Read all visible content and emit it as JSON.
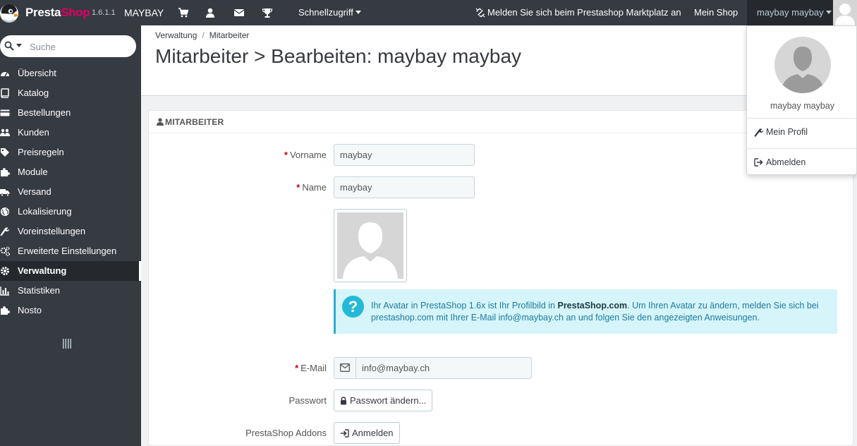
{
  "header": {
    "logo_presta": "Presta",
    "logo_shop": "Shop",
    "version": "1.6.1.1",
    "shop_name": "MAYBAY",
    "quick_access": "Schnellzugriff",
    "marketplace": "Melden Sie sich beim Prestashop Marktplatz an",
    "my_shop": "Mein Shop",
    "user": "maybay maybay"
  },
  "search": {
    "placeholder": "Suche"
  },
  "sidebar": {
    "items": [
      {
        "label": "Übersicht",
        "icon": "dashboard-icon"
      },
      {
        "label": "Katalog",
        "icon": "book-icon"
      },
      {
        "label": "Bestellungen",
        "icon": "credit-card-icon"
      },
      {
        "label": "Kunden",
        "icon": "users-icon"
      },
      {
        "label": "Preisregeln",
        "icon": "tags-icon"
      },
      {
        "label": "Module",
        "icon": "puzzle-icon"
      },
      {
        "label": "Versand",
        "icon": "truck-icon"
      },
      {
        "label": "Lokalisierung",
        "icon": "globe-icon"
      },
      {
        "label": "Voreinstellungen",
        "icon": "wrench-icon"
      },
      {
        "label": "Erweiterte Einstellungen",
        "icon": "cogs-icon"
      },
      {
        "label": "Verwaltung",
        "icon": "cog-icon",
        "active": true
      },
      {
        "label": "Statistiken",
        "icon": "bar-chart-icon"
      },
      {
        "label": "Nosto",
        "icon": "puzzle-icon"
      }
    ]
  },
  "breadcrumb": {
    "parent": "Verwaltung",
    "sep": "/",
    "current": "Mitarbeiter"
  },
  "page_title": "Mitarbeiter > Bearbeiten: maybay maybay",
  "panel": {
    "heading": "Mitarbeiter",
    "fields": {
      "firstname_label": "Vorname",
      "firstname_value": "maybay",
      "lastname_label": "Name",
      "lastname_value": "maybay",
      "email_label": "E-Mail",
      "email_value": "info@maybay.ch",
      "password_label": "Passwort",
      "password_button": "Passwort ändern...",
      "addons_label": "PrestaShop Addons",
      "addons_button": "Anmelden",
      "required_mark": "*"
    },
    "avatar_info": {
      "text_1": "Ihr Avatar in PrestaShop 1.6x ist Ihr Profilbild in ",
      "text_bold": "PrestaShop.com",
      "text_2": ". Um Ihren Avatar zu ändern, melden Sie sich bei prestashop.com mit Ihrer E-Mail info@maybay.ch an und folgen Sie den angezeigten Anweisungen.",
      "icon": "?"
    }
  },
  "user_dropdown": {
    "name": "maybay maybay",
    "my_profile": "Mein Profil",
    "logout": "Abmelden"
  },
  "colors": {
    "header_bg": "#363a41",
    "accent_pink": "#df0067",
    "info_bg": "#d5f5fb",
    "info_icon": "#25b9d7",
    "required": "#c7000b"
  }
}
